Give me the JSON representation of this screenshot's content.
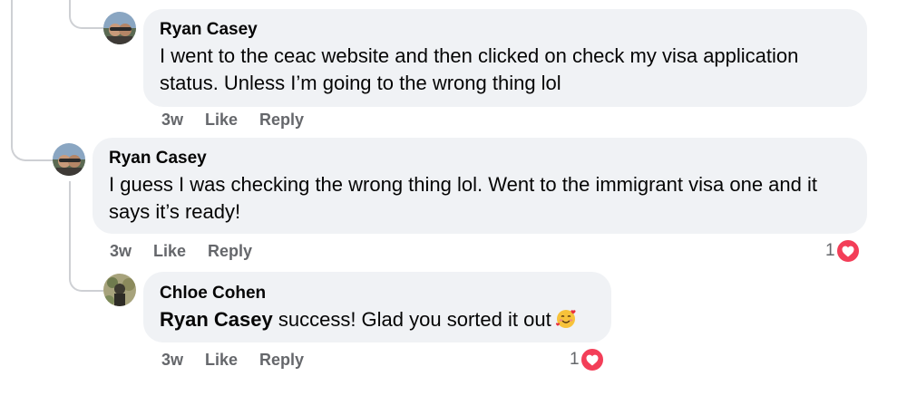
{
  "comments": [
    {
      "author": "Ryan Casey",
      "text": "I went to the ceac website and then clicked on check my visa application status. Unless I’m going to the wrong thing lol",
      "time": "3w",
      "like": "Like",
      "reply": "Reply"
    },
    {
      "author": "Ryan Casey",
      "text": "I guess I was checking the wrong thing lol. Went to the immigrant visa one and it says it’s ready!",
      "time": "3w",
      "like": "Like",
      "reply": "Reply",
      "reaction_count": "1",
      "reaction_icon": "heart-icon"
    },
    {
      "author": "Chloe Cohen",
      "mention": "Ryan Casey",
      "text": " success! Glad you sorted it out",
      "emoji": "smiling-face-with-hearts",
      "time": "3w",
      "like": "Like",
      "reply": "Reply",
      "reaction_count": "1",
      "reaction_icon": "heart-icon"
    }
  ],
  "colors": {
    "bubble": "#f0f2f5",
    "secondary_text": "#65676b",
    "thread_line": "#ced0d4",
    "love_reaction": "#f33e58"
  }
}
